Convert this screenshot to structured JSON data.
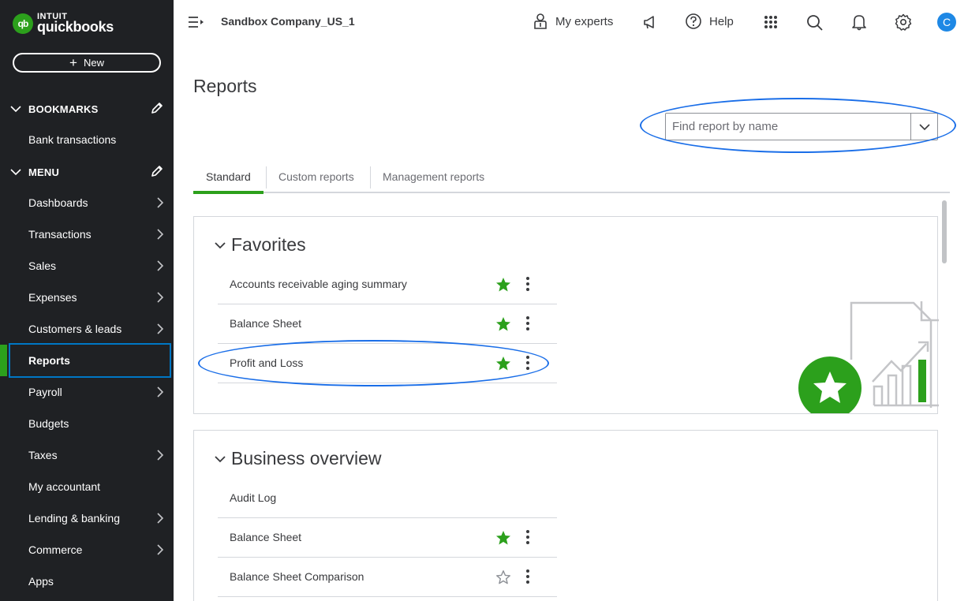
{
  "brand": {
    "intuit": "INTUIT",
    "quickbooks": "quickbooks",
    "logo_glyph": "qb",
    "color": "#2ca01c"
  },
  "sidebar": {
    "new_label": "New",
    "bookmarks": {
      "heading": "BOOKMARKS",
      "items": [
        {
          "label": "Bank transactions"
        }
      ]
    },
    "menu": {
      "heading": "MENU",
      "items": [
        {
          "label": "Dashboards",
          "has_arrow": true
        },
        {
          "label": "Transactions",
          "has_arrow": true
        },
        {
          "label": "Sales",
          "has_arrow": true
        },
        {
          "label": "Expenses",
          "has_arrow": true
        },
        {
          "label": "Customers & leads",
          "has_arrow": true
        },
        {
          "label": "Reports",
          "has_arrow": false,
          "active": true
        },
        {
          "label": "Payroll",
          "has_arrow": true
        },
        {
          "label": "Budgets",
          "has_arrow": false
        },
        {
          "label": "Taxes",
          "has_arrow": true
        },
        {
          "label": "My accountant",
          "has_arrow": false
        },
        {
          "label": "Lending & banking",
          "has_arrow": true
        },
        {
          "label": "Commerce",
          "has_arrow": true
        },
        {
          "label": "Apps",
          "has_arrow": false
        }
      ]
    }
  },
  "topbar": {
    "company": "Sandbox Company_US_1",
    "my_experts": "My experts",
    "help": "Help",
    "avatar_initial": "C",
    "icons": [
      "menu-toggle-icon",
      "person-icon",
      "megaphone-icon",
      "help-icon",
      "apps-grid-icon",
      "search-icon",
      "bell-icon",
      "gear-icon"
    ]
  },
  "main": {
    "title": "Reports",
    "search": {
      "placeholder": "Find report by name",
      "value": ""
    },
    "tabs": [
      {
        "label": "Standard",
        "active": true
      },
      {
        "label": "Custom reports"
      },
      {
        "label": "Management reports"
      }
    ],
    "favorites": {
      "title": "Favorites",
      "rows": [
        {
          "label": "Accounts receivable aging summary",
          "starred": true
        },
        {
          "label": "Balance Sheet",
          "starred": true
        },
        {
          "label": "Profit and Loss",
          "starred": true
        }
      ]
    },
    "business_overview": {
      "title": "Business overview",
      "rows": [
        {
          "label": "Audit Log",
          "starred": null
        },
        {
          "label": "Balance Sheet",
          "starred": true
        },
        {
          "label": "Balance Sheet Comparison",
          "starred": false
        }
      ]
    }
  },
  "colors": {
    "sidebar_bg": "#1f2124",
    "accent_green": "#2ca01c",
    "annotation_blue": "#1a6ee8",
    "star_green": "#2ca01c"
  }
}
